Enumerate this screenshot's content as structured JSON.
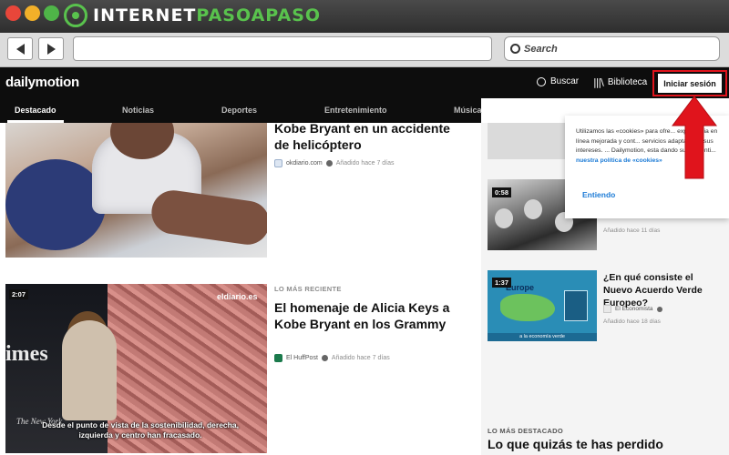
{
  "window": {
    "brand_prefix": "INTERNET",
    "brand_accent": "PASOAPASO",
    "search_placeholder": "Search"
  },
  "dm": {
    "logo": "dailymotion",
    "search_label": "Buscar",
    "library_label": "Biblioteca",
    "login_label": "Iniciar sesión",
    "nav_tabs": [
      "Destacado",
      "Noticias",
      "Deportes",
      "Entretenimiento",
      "Música"
    ]
  },
  "main": {
    "card1": {
      "headline": "Kobe Bryant en un accidente de helicóptero",
      "source": "okdiario.com",
      "ago": "Añadido hace 7 días"
    },
    "card2": {
      "kicker": "LO MÁS RECIENTE",
      "duration": "2:07",
      "headline": "El homenaje de Alicia Keys a Kobe Bryant en los Grammy",
      "source": "El HuffPost",
      "ago": "Añadido hace 7 días",
      "thumb_brand": "eldiario.es",
      "thumb_times": "imes",
      "thumb_nyt": "The New York",
      "thumb_subtitle": "Desde el punto de vista de la sostenibilidad, derecha, izquierda y centro han fracasado."
    }
  },
  "side": {
    "item1": {
      "duration": "0:58",
      "ago": "Añadido hace 11 días"
    },
    "item2": {
      "duration": "1:37",
      "headline": "¿En qué consiste el Nuevo Acuerdo Verde Europeo?",
      "source": "El Economista",
      "ago": "Añadido hace 18 días",
      "thumb_title": "Europe",
      "thumb_footer": "a la economía verde"
    },
    "kicker": "LO MÁS DESTACADO",
    "section_title": "Lo que quizás te has perdido"
  },
  "cookie": {
    "text": "Utilizamos las «cookies» para ofre... experiencia en línea mejorada y cont... servicios adaptados a sus intereses. ... Dailymotion, esta dando su consenti...",
    "link": "nuestra política de «cookies»",
    "accept": "Entiendo"
  },
  "colors": {
    "brand_green": "#59c24d",
    "highlight_red": "#e0141c",
    "dm_link_blue": "#1c7bd6"
  }
}
